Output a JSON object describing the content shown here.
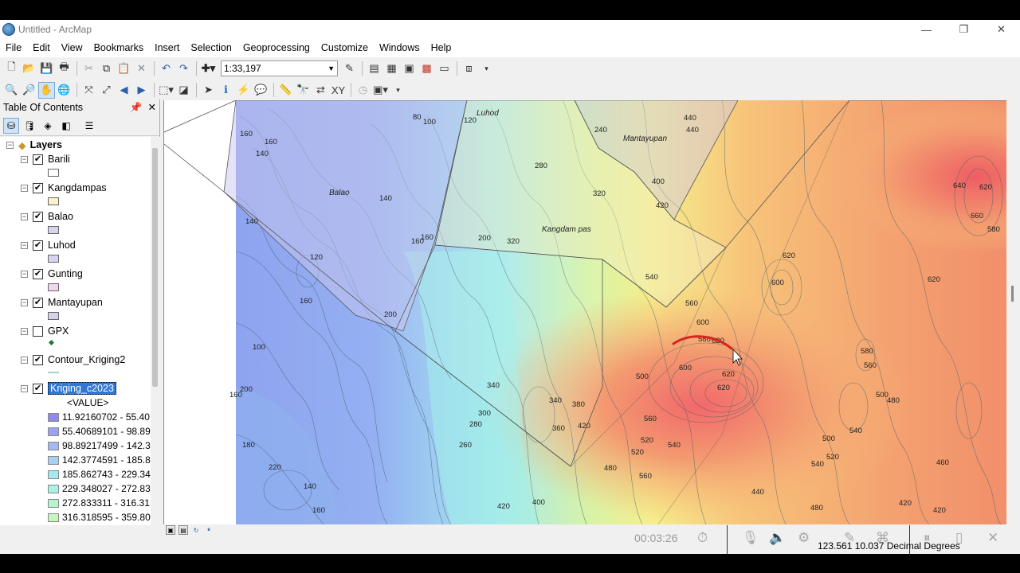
{
  "window": {
    "title": "Untitled - ArcMap",
    "minimize": "—",
    "restore": "❐",
    "close": "✕"
  },
  "menu": [
    "File",
    "Edit",
    "View",
    "Bookmarks",
    "Insert",
    "Selection",
    "Geoprocessing",
    "Customize",
    "Windows",
    "Help"
  ],
  "toolbar": {
    "scale_value": "1:33,197"
  },
  "toc": {
    "title": "Table Of Contents",
    "root": "Layers",
    "layers": [
      {
        "name": "Barili",
        "checked": true,
        "symbol": "#ffffff"
      },
      {
        "name": "Kangdampas",
        "checked": true,
        "symbol": "#fdf2c8"
      },
      {
        "name": "Balao",
        "checked": true,
        "symbol": "#d9d4ee"
      },
      {
        "name": "Luhod",
        "checked": true,
        "symbol": "#d6d3f2"
      },
      {
        "name": "Gunting",
        "checked": true,
        "symbol": "#f1d7ee"
      },
      {
        "name": "Mantayupan",
        "checked": true,
        "symbol": "#d9d1ec"
      },
      {
        "name": "GPX",
        "checked": false,
        "symbol": "#1e7a3a"
      },
      {
        "name": "Contour_Kriging2",
        "checked": true,
        "symbol": "#9fd4d8"
      },
      {
        "name": "Kriging_c2023",
        "checked": true,
        "symbol": ""
      }
    ],
    "value_label": "<VALUE>",
    "classes": [
      {
        "label": "11.92160702 - 55.40",
        "color": "#8f8af0"
      },
      {
        "label": "55.40689101 - 98.89",
        "color": "#99a3f2"
      },
      {
        "label": "98.89217499 - 142.3",
        "color": "#a6b8f4"
      },
      {
        "label": "142.3774591 - 185.8",
        "color": "#a9d0f4"
      },
      {
        "label": "185.862743 - 229.34",
        "color": "#a6e8f2"
      },
      {
        "label": "229.348027 - 272.83",
        "color": "#a8f2e4"
      },
      {
        "label": "272.833311 - 316.31",
        "color": "#b5f4cf"
      },
      {
        "label": "316.318595 - 359.80",
        "color": "#c8f5b9"
      }
    ]
  },
  "map": {
    "polygon_labels": [
      "Luhod",
      "Mantayupan",
      "Balao",
      "Kangdam pas"
    ],
    "contour_labels": [
      "80",
      "100",
      "120",
      "160",
      "160",
      "140",
      "160",
      "200",
      "240",
      "280",
      "320",
      "400",
      "420",
      "440",
      "440",
      "140",
      "160",
      "140",
      "120",
      "160",
      "200",
      "320",
      "340",
      "360",
      "380",
      "420",
      "480",
      "500",
      "520",
      "540",
      "560",
      "580",
      "600",
      "620",
      "620",
      "600",
      "640",
      "660",
      "620",
      "580",
      "620",
      "580",
      "560",
      "540",
      "520",
      "540",
      "500",
      "480",
      "460",
      "420",
      "420",
      "440",
      "480",
      "500",
      "520",
      "560",
      "620",
      "420",
      "400",
      "100",
      "160",
      "200",
      "220",
      "180",
      "140",
      "160",
      "260",
      "280",
      "300",
      "340",
      "560",
      "600",
      "620",
      "540"
    ],
    "colors": {
      "accent": "#d8241e"
    }
  },
  "status": {
    "coordinates": "123.561  10.037 Decimal Degrees",
    "player_time": "00:03:26"
  }
}
